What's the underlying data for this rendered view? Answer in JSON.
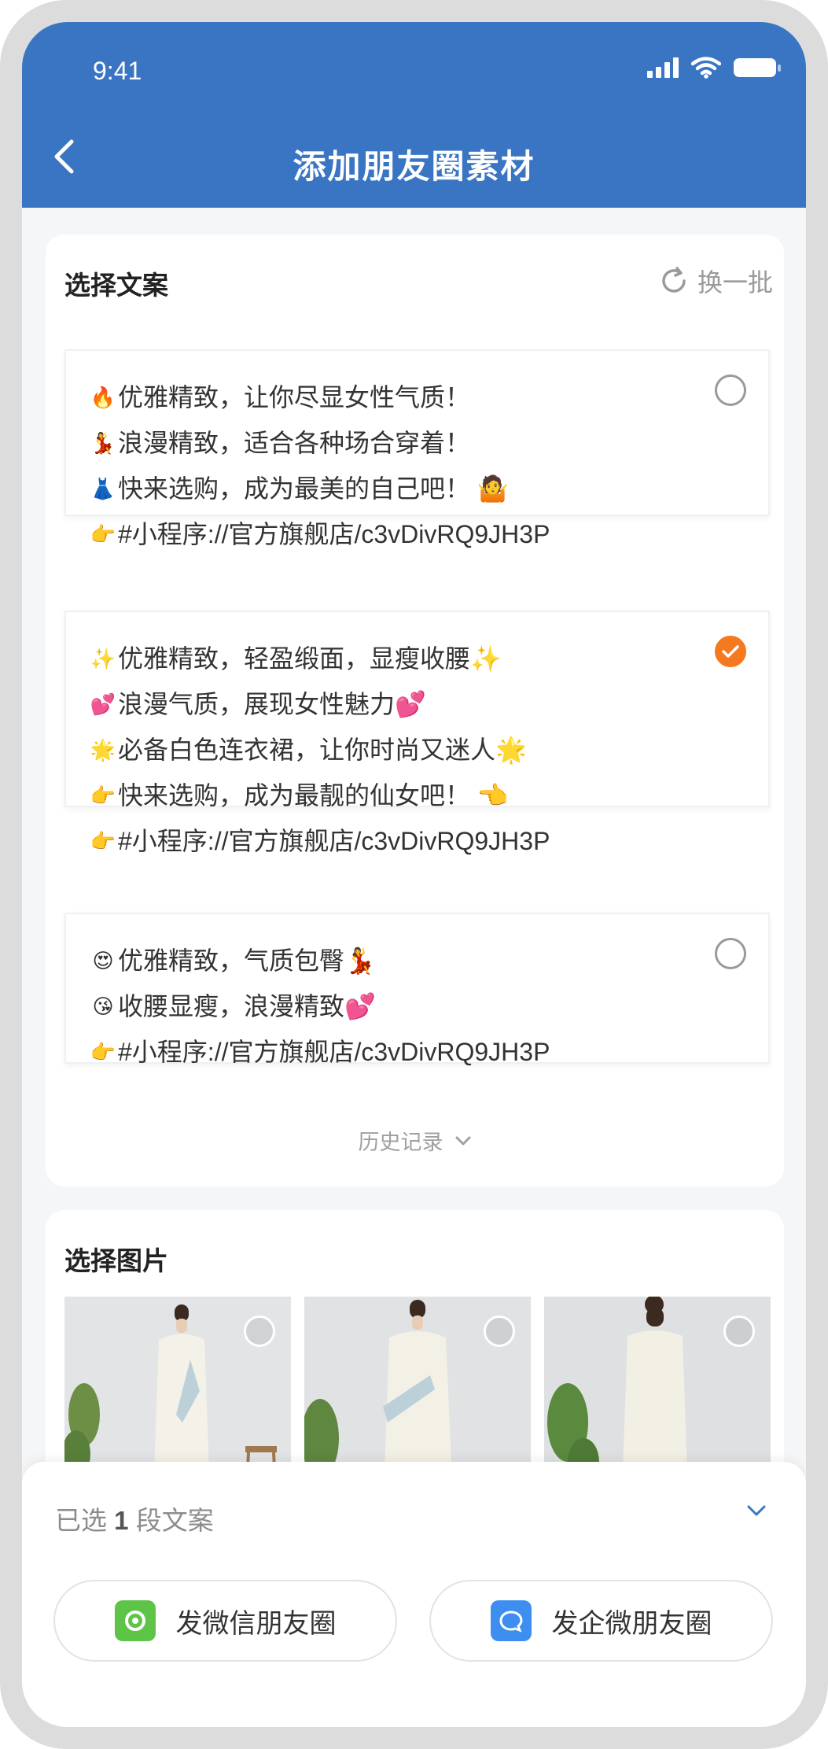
{
  "status_bar": {
    "time": "9:41"
  },
  "header": {
    "title": "添加朋友圈素材"
  },
  "copy_section": {
    "title": "选择文案",
    "refresh_label": "换一批",
    "options": [
      {
        "checked": false,
        "lines": [
          {
            "emoji": "🔥",
            "text": "优雅精致，让你尽显女性气质！"
          },
          {
            "emoji": "💃",
            "text": "浪漫精致，适合各种场合穿着！"
          },
          {
            "emoji": "👗",
            "text": "快来选购，成为最美的自己吧！ 🤷"
          },
          {
            "emoji": "👉",
            "text": "#小程序://官方旗舰店/c3vDivRQ9JH3P"
          }
        ]
      },
      {
        "checked": true,
        "lines": [
          {
            "emoji": "✨",
            "text": "优雅精致，轻盈缎面，显瘦收腰✨"
          },
          {
            "emoji": "💕",
            "text": "浪漫气质，展现女性魅力💕"
          },
          {
            "emoji": "🌟",
            "text": "必备白色连衣裙，让你时尚又迷人🌟"
          },
          {
            "emoji": "👉",
            "text": "快来选购，成为最靓的仙女吧！ 👈"
          },
          {
            "emoji": "👉",
            "text": "#小程序://官方旗舰店/c3vDivRQ9JH3P"
          }
        ]
      },
      {
        "checked": false,
        "lines": [
          {
            "emoji": "😍",
            "text": "优雅精致，气质包臀💃"
          },
          {
            "emoji": "😘",
            "text": "收腰显瘦，浪漫精致💕"
          },
          {
            "emoji": "👉",
            "text": "#小程序://官方旗舰店/c3vDivRQ9JH3P"
          }
        ]
      }
    ],
    "history_label": "历史记录"
  },
  "image_section": {
    "title": "选择图片",
    "images": [
      {
        "checked": false
      },
      {
        "checked": false
      },
      {
        "checked": false
      }
    ]
  },
  "bottom_sheet": {
    "selected_prefix": "已选 ",
    "selected_count": "1",
    "selected_suffix": " 段文案",
    "wechat_button": "发微信朋友圈",
    "wecom_button": "发企微朋友圈"
  },
  "colors": {
    "header_bg": "#3a75c4",
    "accent_orange": "#f5791e",
    "wechat_green": "#5dc448",
    "wecom_blue": "#3d8ef0"
  }
}
